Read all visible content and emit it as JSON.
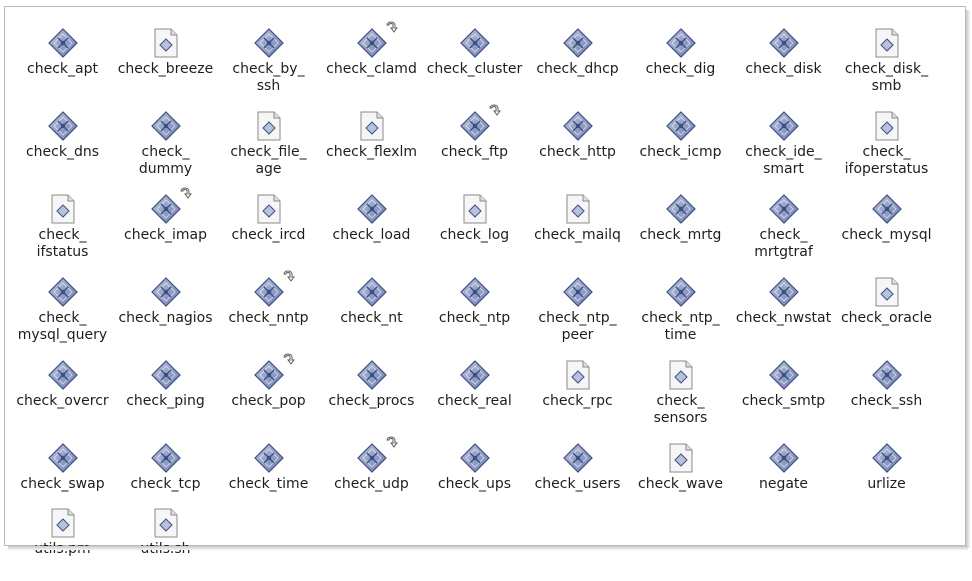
{
  "files": [
    {
      "name": "check_apt",
      "type": "exec",
      "link": false
    },
    {
      "name": "check_breeze",
      "type": "text",
      "link": false
    },
    {
      "name": "check_by_\nssh",
      "type": "exec",
      "link": false
    },
    {
      "name": "check_clamd",
      "type": "exec",
      "link": true
    },
    {
      "name": "check_cluster",
      "type": "exec",
      "link": false
    },
    {
      "name": "check_dhcp",
      "type": "exec",
      "link": false
    },
    {
      "name": "check_dig",
      "type": "exec",
      "link": false
    },
    {
      "name": "check_disk",
      "type": "exec",
      "link": false
    },
    {
      "name": "check_disk_\nsmb",
      "type": "text",
      "link": false
    },
    {
      "name": "check_dns",
      "type": "exec",
      "link": false
    },
    {
      "name": "check_\ndummy",
      "type": "exec",
      "link": false
    },
    {
      "name": "check_file_\nage",
      "type": "text",
      "link": false
    },
    {
      "name": "check_flexlm",
      "type": "text",
      "link": false
    },
    {
      "name": "check_ftp",
      "type": "exec",
      "link": true
    },
    {
      "name": "check_http",
      "type": "exec",
      "link": false
    },
    {
      "name": "check_icmp",
      "type": "exec",
      "link": false
    },
    {
      "name": "check_ide_\nsmart",
      "type": "exec",
      "link": false
    },
    {
      "name": "check_\nifoperstatus",
      "type": "text",
      "link": false
    },
    {
      "name": "check_\nifstatus",
      "type": "text",
      "link": false
    },
    {
      "name": "check_imap",
      "type": "exec",
      "link": true
    },
    {
      "name": "check_ircd",
      "type": "text",
      "link": false
    },
    {
      "name": "check_load",
      "type": "exec",
      "link": false
    },
    {
      "name": "check_log",
      "type": "text",
      "link": false
    },
    {
      "name": "check_mailq",
      "type": "text",
      "link": false
    },
    {
      "name": "check_mrtg",
      "type": "exec",
      "link": false
    },
    {
      "name": "check_\nmrtgtraf",
      "type": "exec",
      "link": false
    },
    {
      "name": "check_mysql",
      "type": "exec",
      "link": false
    },
    {
      "name": "check_\nmysql_query",
      "type": "exec",
      "link": false
    },
    {
      "name": "check_nagios",
      "type": "exec",
      "link": false
    },
    {
      "name": "check_nntp",
      "type": "exec",
      "link": true
    },
    {
      "name": "check_nt",
      "type": "exec",
      "link": false
    },
    {
      "name": "check_ntp",
      "type": "exec",
      "link": false
    },
    {
      "name": "check_ntp_\npeer",
      "type": "exec",
      "link": false
    },
    {
      "name": "check_ntp_\ntime",
      "type": "exec",
      "link": false
    },
    {
      "name": "check_nwstat",
      "type": "exec",
      "link": false
    },
    {
      "name": "check_oracle",
      "type": "text",
      "link": false
    },
    {
      "name": "check_overcr",
      "type": "exec",
      "link": false
    },
    {
      "name": "check_ping",
      "type": "exec",
      "link": false
    },
    {
      "name": "check_pop",
      "type": "exec",
      "link": true
    },
    {
      "name": "check_procs",
      "type": "exec",
      "link": false
    },
    {
      "name": "check_real",
      "type": "exec",
      "link": false
    },
    {
      "name": "check_rpc",
      "type": "text",
      "link": false
    },
    {
      "name": "check_\nsensors",
      "type": "text",
      "link": false
    },
    {
      "name": "check_smtp",
      "type": "exec",
      "link": false
    },
    {
      "name": "check_ssh",
      "type": "exec",
      "link": false
    },
    {
      "name": "check_swap",
      "type": "exec",
      "link": false
    },
    {
      "name": "check_tcp",
      "type": "exec",
      "link": false
    },
    {
      "name": "check_time",
      "type": "exec",
      "link": false
    },
    {
      "name": "check_udp",
      "type": "exec",
      "link": true
    },
    {
      "name": "check_ups",
      "type": "exec",
      "link": false
    },
    {
      "name": "check_users",
      "type": "exec",
      "link": false
    },
    {
      "name": "check_wave",
      "type": "text",
      "link": false
    },
    {
      "name": "negate",
      "type": "exec",
      "link": false
    },
    {
      "name": "urlize",
      "type": "exec",
      "link": false
    },
    {
      "name": "utils.pm",
      "type": "text",
      "link": false
    },
    {
      "name": "utils.sh",
      "type": "text",
      "link": false
    }
  ],
  "colors": {
    "exec_light": "#b9c2da",
    "exec_dark": "#3d4f86",
    "exec_mid": "#6f80b0",
    "doc_fill": "#f6f6f6",
    "doc_stroke": "#8a8a8a",
    "label": "#1e1e1e"
  }
}
